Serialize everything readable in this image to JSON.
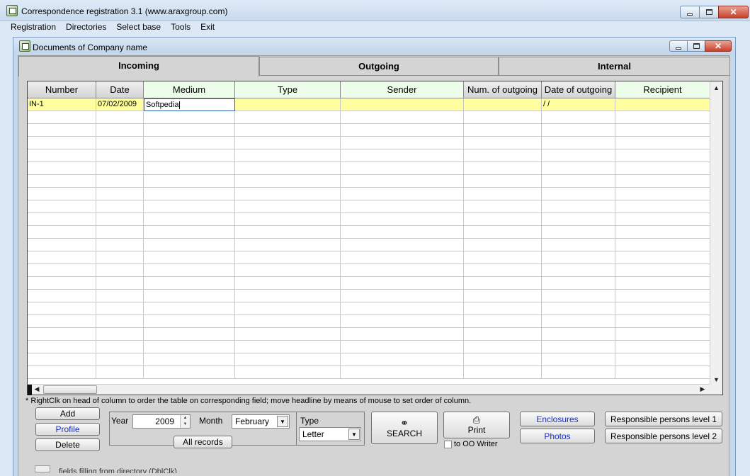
{
  "window": {
    "title": "Correspondence registration 3.1 (www.araxgroup.com)"
  },
  "menu": [
    "Registration",
    "Directories",
    "Select base",
    "Tools",
    "Exit"
  ],
  "document_window": {
    "title": "Documents of Company name"
  },
  "tabs": [
    "Incoming",
    "Outgoing",
    "Internal"
  ],
  "active_tab": "Incoming",
  "grid": {
    "columns": [
      "Number",
      "Date",
      "Medium",
      "Type",
      "Sender",
      "Num. of outgoing",
      "Date of outgoing",
      "Recipient"
    ],
    "rows": [
      [
        "IN-1",
        "07/02/2009",
        "Softpedia",
        "",
        "",
        "",
        "/ /",
        ""
      ]
    ]
  },
  "hint": "* RightClk on head of column to order the table on corresponding field;  move  headline by means of mouse to set order of column.",
  "buttons": {
    "add": "Add",
    "profile": "Profile",
    "delete": "Delete",
    "all_records": "All records",
    "search": "SEARCH",
    "print": "Print",
    "enclosures": "Enclosures",
    "photos": "Photos",
    "resp1": "Responsible persons level 1",
    "resp2": "Responsible persons level 2"
  },
  "filters": {
    "year_label": "Year",
    "year_value": "2009",
    "month_label": "Month",
    "month_value": "February",
    "type_label": "Type",
    "type_value": "Letter"
  },
  "print_option": "to OO Writer",
  "status_text": "fields filling from directory (DblClk)",
  "colors": {
    "selected_row": "#ffff9e",
    "header_green": "#ecfde9",
    "blue_button_text": "#1a2fbf"
  }
}
